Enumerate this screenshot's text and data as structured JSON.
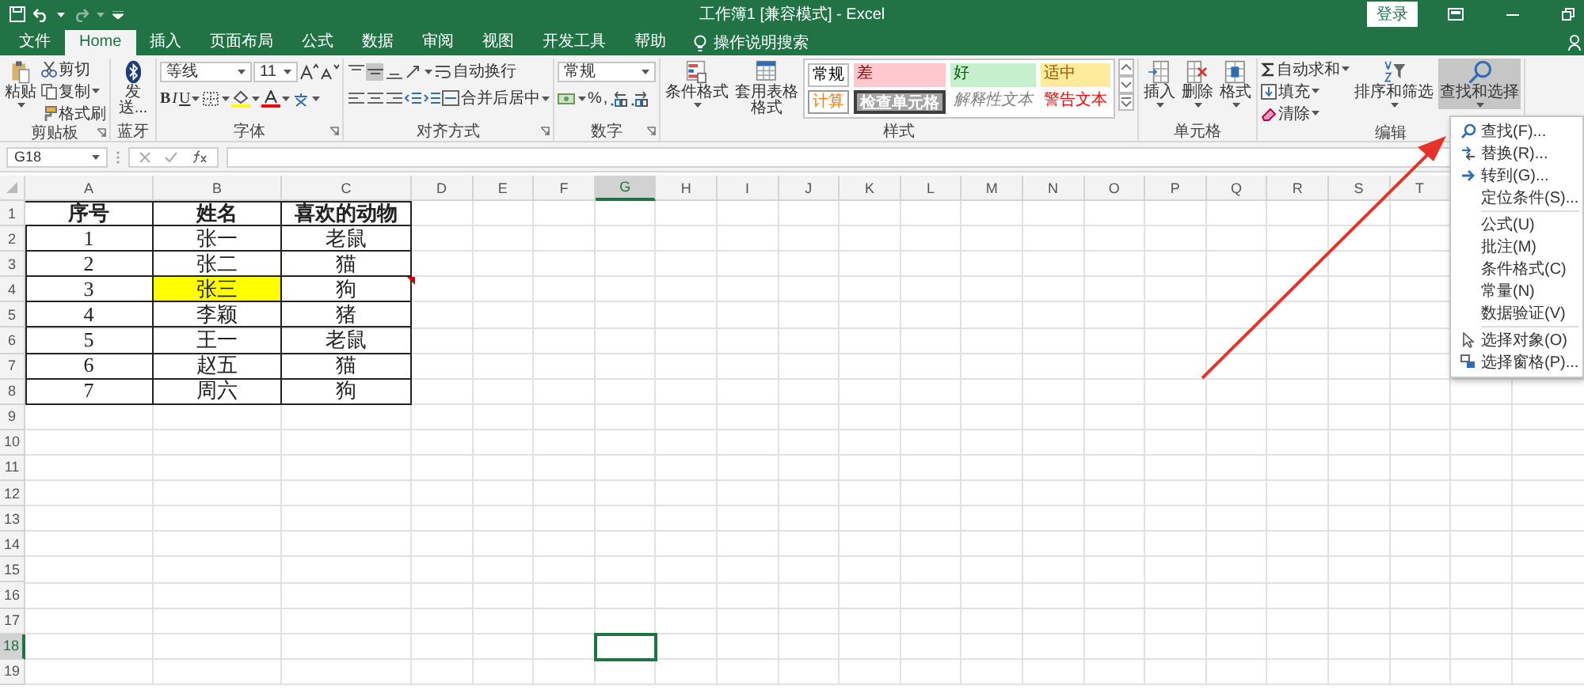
{
  "window": {
    "title": "工作簿1 [兼容模式] - Excel",
    "login": "登录"
  },
  "tabs": [
    {
      "label": "文件",
      "selected": false
    },
    {
      "label": "Home",
      "selected": true
    },
    {
      "label": "插入",
      "selected": false
    },
    {
      "label": "页面布局",
      "selected": false
    },
    {
      "label": "公式",
      "selected": false
    },
    {
      "label": "数据",
      "selected": false
    },
    {
      "label": "审阅",
      "selected": false
    },
    {
      "label": "视图",
      "selected": false
    },
    {
      "label": "开发工具",
      "selected": false
    },
    {
      "label": "帮助",
      "selected": false
    }
  ],
  "tell_me": "操作说明搜索",
  "ribbon": {
    "groups": [
      {
        "kind": "clipboard",
        "label": "剪贴板",
        "buttons": [
          "粘贴",
          "剪切",
          "复制",
          "格式刷"
        ]
      },
      {
        "kind": "bluetooth",
        "label": "蓝牙",
        "buttons": [
          "发送..."
        ]
      },
      {
        "kind": "font",
        "label": "字体",
        "font_name": "等线",
        "font_size": "11",
        "buttons": [
          "B",
          "I",
          "U"
        ]
      },
      {
        "kind": "alignment",
        "label": "对齐方式",
        "buttons": [
          "自动换行",
          "合并后居中"
        ]
      },
      {
        "kind": "number",
        "label": "数字",
        "format": "常规",
        "buttons": [
          "%",
          ","
        ]
      },
      {
        "kind": "styles",
        "label": "样式",
        "buttons": [
          "条件格式",
          "套用表格格式"
        ],
        "styles": [
          {
            "label": "常规",
            "kind": "normal"
          },
          {
            "label": "差",
            "kind": "bad"
          },
          {
            "label": "好",
            "kind": "good"
          },
          {
            "label": "适中",
            "kind": "neutral"
          },
          {
            "label": "计算",
            "kind": "calculation"
          },
          {
            "label": "检查单元格",
            "kind": "check"
          },
          {
            "label": "解释性文本",
            "kind": "explanatory"
          },
          {
            "label": "警告文本",
            "kind": "warning"
          }
        ]
      },
      {
        "kind": "cells",
        "label": "单元格",
        "buttons": [
          "插入",
          "删除",
          "格式"
        ]
      },
      {
        "kind": "editing",
        "label": "编辑",
        "buttons": [
          {
            "label": "自动求和",
            "selected": false
          },
          {
            "label": "填充",
            "selected": false
          },
          {
            "label": "清除",
            "selected": false
          },
          {
            "label": "排序和筛选",
            "selected": false
          },
          {
            "label": "查找和选择",
            "selected": true
          }
        ]
      }
    ]
  },
  "formula_bar": {
    "name_box": "G18"
  },
  "sheet": {
    "columns": [
      {
        "label": "A",
        "selected": false
      },
      {
        "label": "B",
        "selected": false
      },
      {
        "label": "C",
        "selected": false
      },
      {
        "label": "D",
        "selected": false
      },
      {
        "label": "E",
        "selected": false
      },
      {
        "label": "F",
        "selected": false
      },
      {
        "label": "G",
        "selected": true
      },
      {
        "label": "H",
        "selected": false
      },
      {
        "label": "I",
        "selected": false
      },
      {
        "label": "J",
        "selected": false
      },
      {
        "label": "K",
        "selected": false
      },
      {
        "label": "L",
        "selected": false
      },
      {
        "label": "M",
        "selected": false
      },
      {
        "label": "N",
        "selected": false
      },
      {
        "label": "O",
        "selected": false
      },
      {
        "label": "P",
        "selected": false
      },
      {
        "label": "Q",
        "selected": false
      },
      {
        "label": "R",
        "selected": false
      },
      {
        "label": "S",
        "selected": false
      },
      {
        "label": "T",
        "selected": false
      }
    ],
    "rows": [
      {
        "label": "1",
        "selected": false
      },
      {
        "label": "2",
        "selected": false
      },
      {
        "label": "3",
        "selected": false
      },
      {
        "label": "4",
        "selected": false
      },
      {
        "label": "5",
        "selected": false
      },
      {
        "label": "6",
        "selected": false
      },
      {
        "label": "7",
        "selected": false
      },
      {
        "label": "8",
        "selected": false
      },
      {
        "label": "9",
        "selected": false
      },
      {
        "label": "10",
        "selected": false
      },
      {
        "label": "11",
        "selected": false
      },
      {
        "label": "12",
        "selected": false
      },
      {
        "label": "13",
        "selected": false
      },
      {
        "label": "14",
        "selected": false
      },
      {
        "label": "15",
        "selected": false
      },
      {
        "label": "16",
        "selected": false
      },
      {
        "label": "17",
        "selected": false
      },
      {
        "label": "18",
        "selected": true
      },
      {
        "label": "19",
        "selected": false
      }
    ],
    "table": {
      "header": [
        "序号",
        "姓名",
        "喜欢的动物"
      ],
      "rows": [
        {
          "cells": [
            {
              "text": "1",
              "highlighted": false,
              "comment": false
            },
            {
              "text": "张一",
              "highlighted": false,
              "comment": false
            },
            {
              "text": "老鼠",
              "highlighted": false,
              "comment": false
            }
          ]
        },
        {
          "cells": [
            {
              "text": "2",
              "highlighted": false,
              "comment": false
            },
            {
              "text": "张二",
              "highlighted": false,
              "comment": false
            },
            {
              "text": "猫",
              "highlighted": false,
              "comment": false
            }
          ]
        },
        {
          "cells": [
            {
              "text": "3",
              "highlighted": false,
              "comment": false
            },
            {
              "text": "张三",
              "highlighted": true,
              "comment": false
            },
            {
              "text": "狗",
              "highlighted": false,
              "comment": true
            }
          ]
        },
        {
          "cells": [
            {
              "text": "4",
              "highlighted": false,
              "comment": false
            },
            {
              "text": "李颖",
              "highlighted": false,
              "comment": false
            },
            {
              "text": "猪",
              "highlighted": false,
              "comment": false
            }
          ]
        },
        {
          "cells": [
            {
              "text": "5",
              "highlighted": false,
              "comment": false
            },
            {
              "text": "王一",
              "highlighted": false,
              "comment": false
            },
            {
              "text": "老鼠",
              "highlighted": false,
              "comment": false
            }
          ]
        },
        {
          "cells": [
            {
              "text": "6",
              "highlighted": false,
              "comment": false
            },
            {
              "text": "赵五",
              "highlighted": false,
              "comment": false
            },
            {
              "text": "猫",
              "highlighted": false,
              "comment": false
            }
          ]
        },
        {
          "cells": [
            {
              "text": "7",
              "highlighted": false,
              "comment": false
            },
            {
              "text": "周六",
              "highlighted": false,
              "comment": false
            },
            {
              "text": "狗",
              "highlighted": false,
              "comment": false
            }
          ]
        }
      ]
    }
  },
  "menu": {
    "sections": [
      [
        "查找(F)...",
        "替换(R)...",
        "转到(G)...",
        "定位条件(S)..."
      ],
      [
        "公式(U)",
        "批注(M)",
        "条件格式(C)",
        "常量(N)",
        "数据验证(V)"
      ],
      [
        "选择对象(O)",
        "选择窗格(P)..."
      ]
    ]
  }
}
